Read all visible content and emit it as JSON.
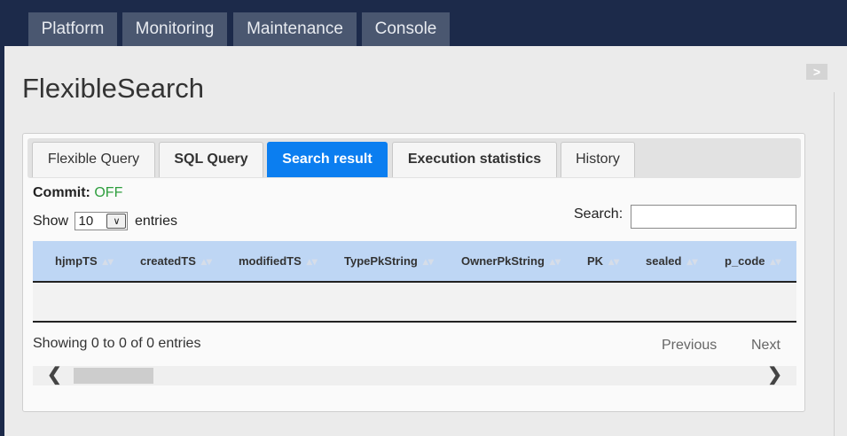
{
  "topnav": {
    "tabs": [
      "Platform",
      "Monitoring",
      "Maintenance",
      "Console"
    ]
  },
  "page": {
    "title": "FlexibleSearch",
    "collapse_label": ">"
  },
  "tabs": [
    {
      "label": "Flexible Query",
      "active": false
    },
    {
      "label": "SQL Query",
      "active": false
    },
    {
      "label": "Search result",
      "active": true
    },
    {
      "label": "Execution statistics",
      "active": false
    },
    {
      "label": "History",
      "active": false
    }
  ],
  "commit": {
    "label": "Commit:",
    "value": "OFF"
  },
  "length_menu": {
    "show_label": "Show",
    "value": "10",
    "entries_label": "entries"
  },
  "search": {
    "label": "Search:",
    "value": ""
  },
  "table": {
    "columns": [
      "hjmpTS",
      "createdTS",
      "modifiedTS",
      "TypePkString",
      "OwnerPkString",
      "PK",
      "sealed",
      "p_code"
    ],
    "rows": []
  },
  "info": "Showing 0 to 0 of 0 entries",
  "pager": {
    "previous": "Previous",
    "next": "Next"
  },
  "icons": {
    "select_arrow": "chevron-down-icon",
    "scroll_left": "chevron-left-icon",
    "scroll_right": "chevron-right-icon"
  },
  "colors": {
    "nav_bg": "#1c2a4a",
    "active_tab": "#0b7ef0",
    "header_row": "#bed6f4",
    "commit_off": "#2e9e3e"
  }
}
